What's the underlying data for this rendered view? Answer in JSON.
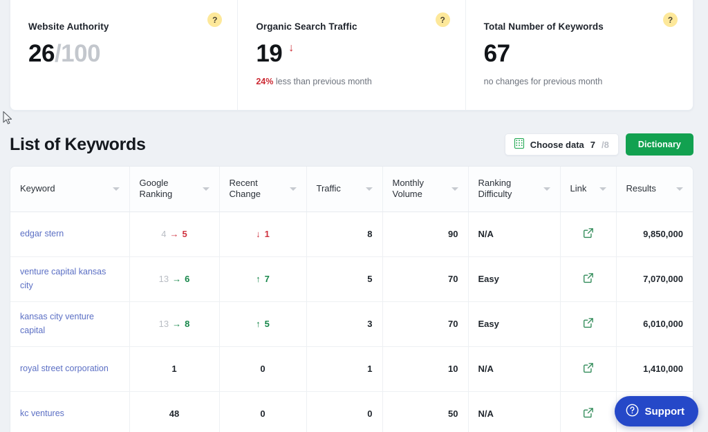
{
  "metrics": [
    {
      "title": "Website Authority",
      "value": "26",
      "value_sub": "/100",
      "arrow": "",
      "note_pct": "",
      "note": "",
      "help": "?"
    },
    {
      "title": "Organic Search Traffic",
      "value": "19",
      "value_sub": "",
      "arrow": "↓",
      "arrow_dir": "down",
      "note_pct": "24%",
      "note": "less than previous month",
      "help": "?"
    },
    {
      "title": "Total Number of Keywords",
      "value": "67",
      "value_sub": "",
      "arrow": "",
      "note_pct": "",
      "note": "no changes for previous month",
      "help": "?"
    }
  ],
  "section": {
    "title": "List of Keywords",
    "choose_data_label": "Choose data",
    "choose_data_current": "7",
    "choose_data_total": "/8",
    "dictionary_label": "Dictionary"
  },
  "table": {
    "columns": [
      "Keyword",
      "Google Ranking",
      "Recent Change",
      "Traffic",
      "Monthly Volume",
      "Ranking Difficulty",
      "Link",
      "Results"
    ],
    "rows": [
      {
        "keyword": "edgar stern",
        "rank_old": "4",
        "rank_arrow": "→",
        "rank_new": "5",
        "rank_dir": "neg",
        "change_arrow": "↓",
        "change_value": "1",
        "change_dir": "neg",
        "traffic": "8",
        "volume": "90",
        "difficulty": "N/A",
        "link_icon": "external-link-icon",
        "results": "9,850,000"
      },
      {
        "keyword": "venture capital kansas city",
        "rank_old": "13",
        "rank_arrow": "→",
        "rank_new": "6",
        "rank_dir": "pos",
        "change_arrow": "↑",
        "change_value": "7",
        "change_dir": "pos",
        "traffic": "5",
        "volume": "70",
        "difficulty": "Easy",
        "link_icon": "external-link-icon",
        "results": "7,070,000"
      },
      {
        "keyword": "kansas city venture capital",
        "rank_old": "13",
        "rank_arrow": "→",
        "rank_new": "8",
        "rank_dir": "pos",
        "change_arrow": "↑",
        "change_value": "5",
        "change_dir": "pos",
        "traffic": "3",
        "volume": "70",
        "difficulty": "Easy",
        "link_icon": "external-link-icon",
        "results": "6,010,000"
      },
      {
        "keyword": "royal street corporation",
        "rank_old": "",
        "rank_arrow": "",
        "rank_new": "1",
        "rank_dir": "neu",
        "change_arrow": "",
        "change_value": "0",
        "change_dir": "neu",
        "traffic": "1",
        "volume": "10",
        "difficulty": "N/A",
        "link_icon": "external-link-icon",
        "results": "1,410,000"
      },
      {
        "keyword": "kc ventures",
        "rank_old": "",
        "rank_arrow": "",
        "rank_new": "48",
        "rank_dir": "neu",
        "change_arrow": "",
        "change_value": "0",
        "change_dir": "neu",
        "traffic": "0",
        "volume": "50",
        "difficulty": "N/A",
        "link_icon": "external-link-icon",
        "results": ""
      }
    ]
  },
  "support": {
    "label": "Support"
  },
  "colors": {
    "green": "#12a150",
    "red": "#cf3340",
    "blue_link": "#5b6fc4",
    "support_blue": "#2548c8",
    "help_badge": "#fde89a"
  }
}
